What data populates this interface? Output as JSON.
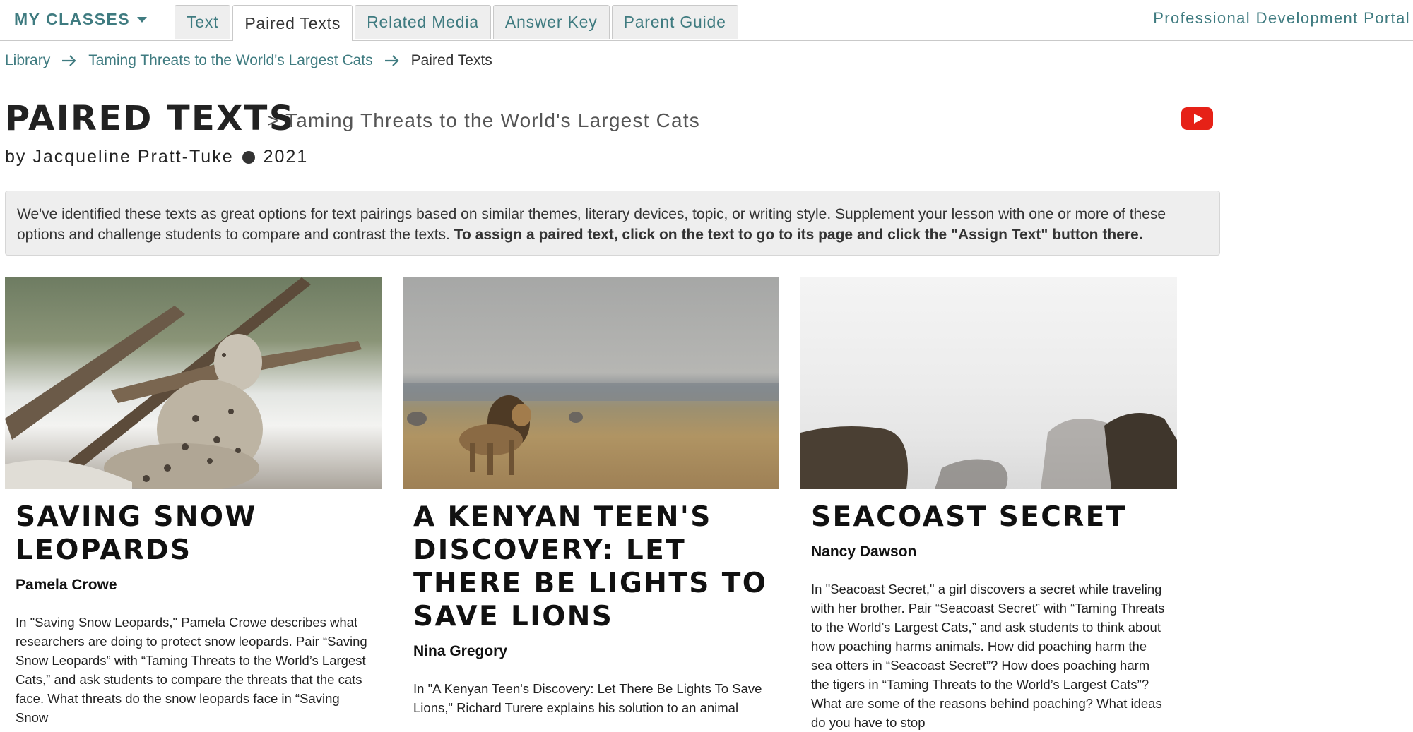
{
  "nav": {
    "my_classes": "MY CLASSES",
    "tabs": [
      "Text",
      "Paired Texts",
      "Related Media",
      "Answer Key",
      "Parent Guide"
    ],
    "active_tab": "Paired Texts",
    "pd_portal": "Professional Development Portal"
  },
  "breadcrumb": {
    "library": "Library",
    "parent": "Taming Threats to the World's Largest Cats",
    "current": "Paired Texts"
  },
  "header": {
    "title": "PAIRED TEXTS",
    "subtitle": "> Taming Threats to the World's Largest Cats",
    "author": "by Jacqueline Pratt-Tuke",
    "year": "2021",
    "video_icon": "youtube-icon"
  },
  "info": {
    "text": "We've identified these texts as great options for text pairings based on similar themes, literary devices, topic, or writing style. Supplement your lesson with one or more of these options and challenge students to compare and contrast the texts. ",
    "bold": "To assign a paired text, click on the text to go to its page and click the \"Assign Text\" button there."
  },
  "cards": [
    {
      "title": "SAVING SNOW LEOPARDS",
      "author": "Pamela Crowe",
      "desc": "In \"Saving Snow Leopards,\" Pamela Crowe describes what researchers are doing to protect snow leopards. Pair “Saving Snow Leopards” with “Taming Threats to the World’s Largest Cats,” and ask students to compare the threats that the cats face. What threats do the snow leopards face in “Saving Snow"
    },
    {
      "title": "A KENYAN TEEN'S DISCOVERY: LET THERE BE LIGHTS TO SAVE LIONS",
      "author": "Nina Gregory",
      "desc": "In \"A Kenyan Teen's Discovery: Let There Be Lights To Save Lions,\" Richard Turere explains his solution to an animal"
    },
    {
      "title": "SEACOAST SECRET",
      "author": "Nancy Dawson",
      "desc": "In \"Seacoast Secret,\" a girl discovers a secret while traveling with her brother. Pair “Seacoast Secret” with “Taming Threats to the World’s Largest Cats,” and ask students to think about how poaching harms animals. How did poaching harm the sea otters in “Seacoast Secret”? How does poaching harm the tigers in “Taming Threats to the World’s Largest Cats”? What are some of the reasons behind poaching? What ideas do you have to stop"
    }
  ]
}
